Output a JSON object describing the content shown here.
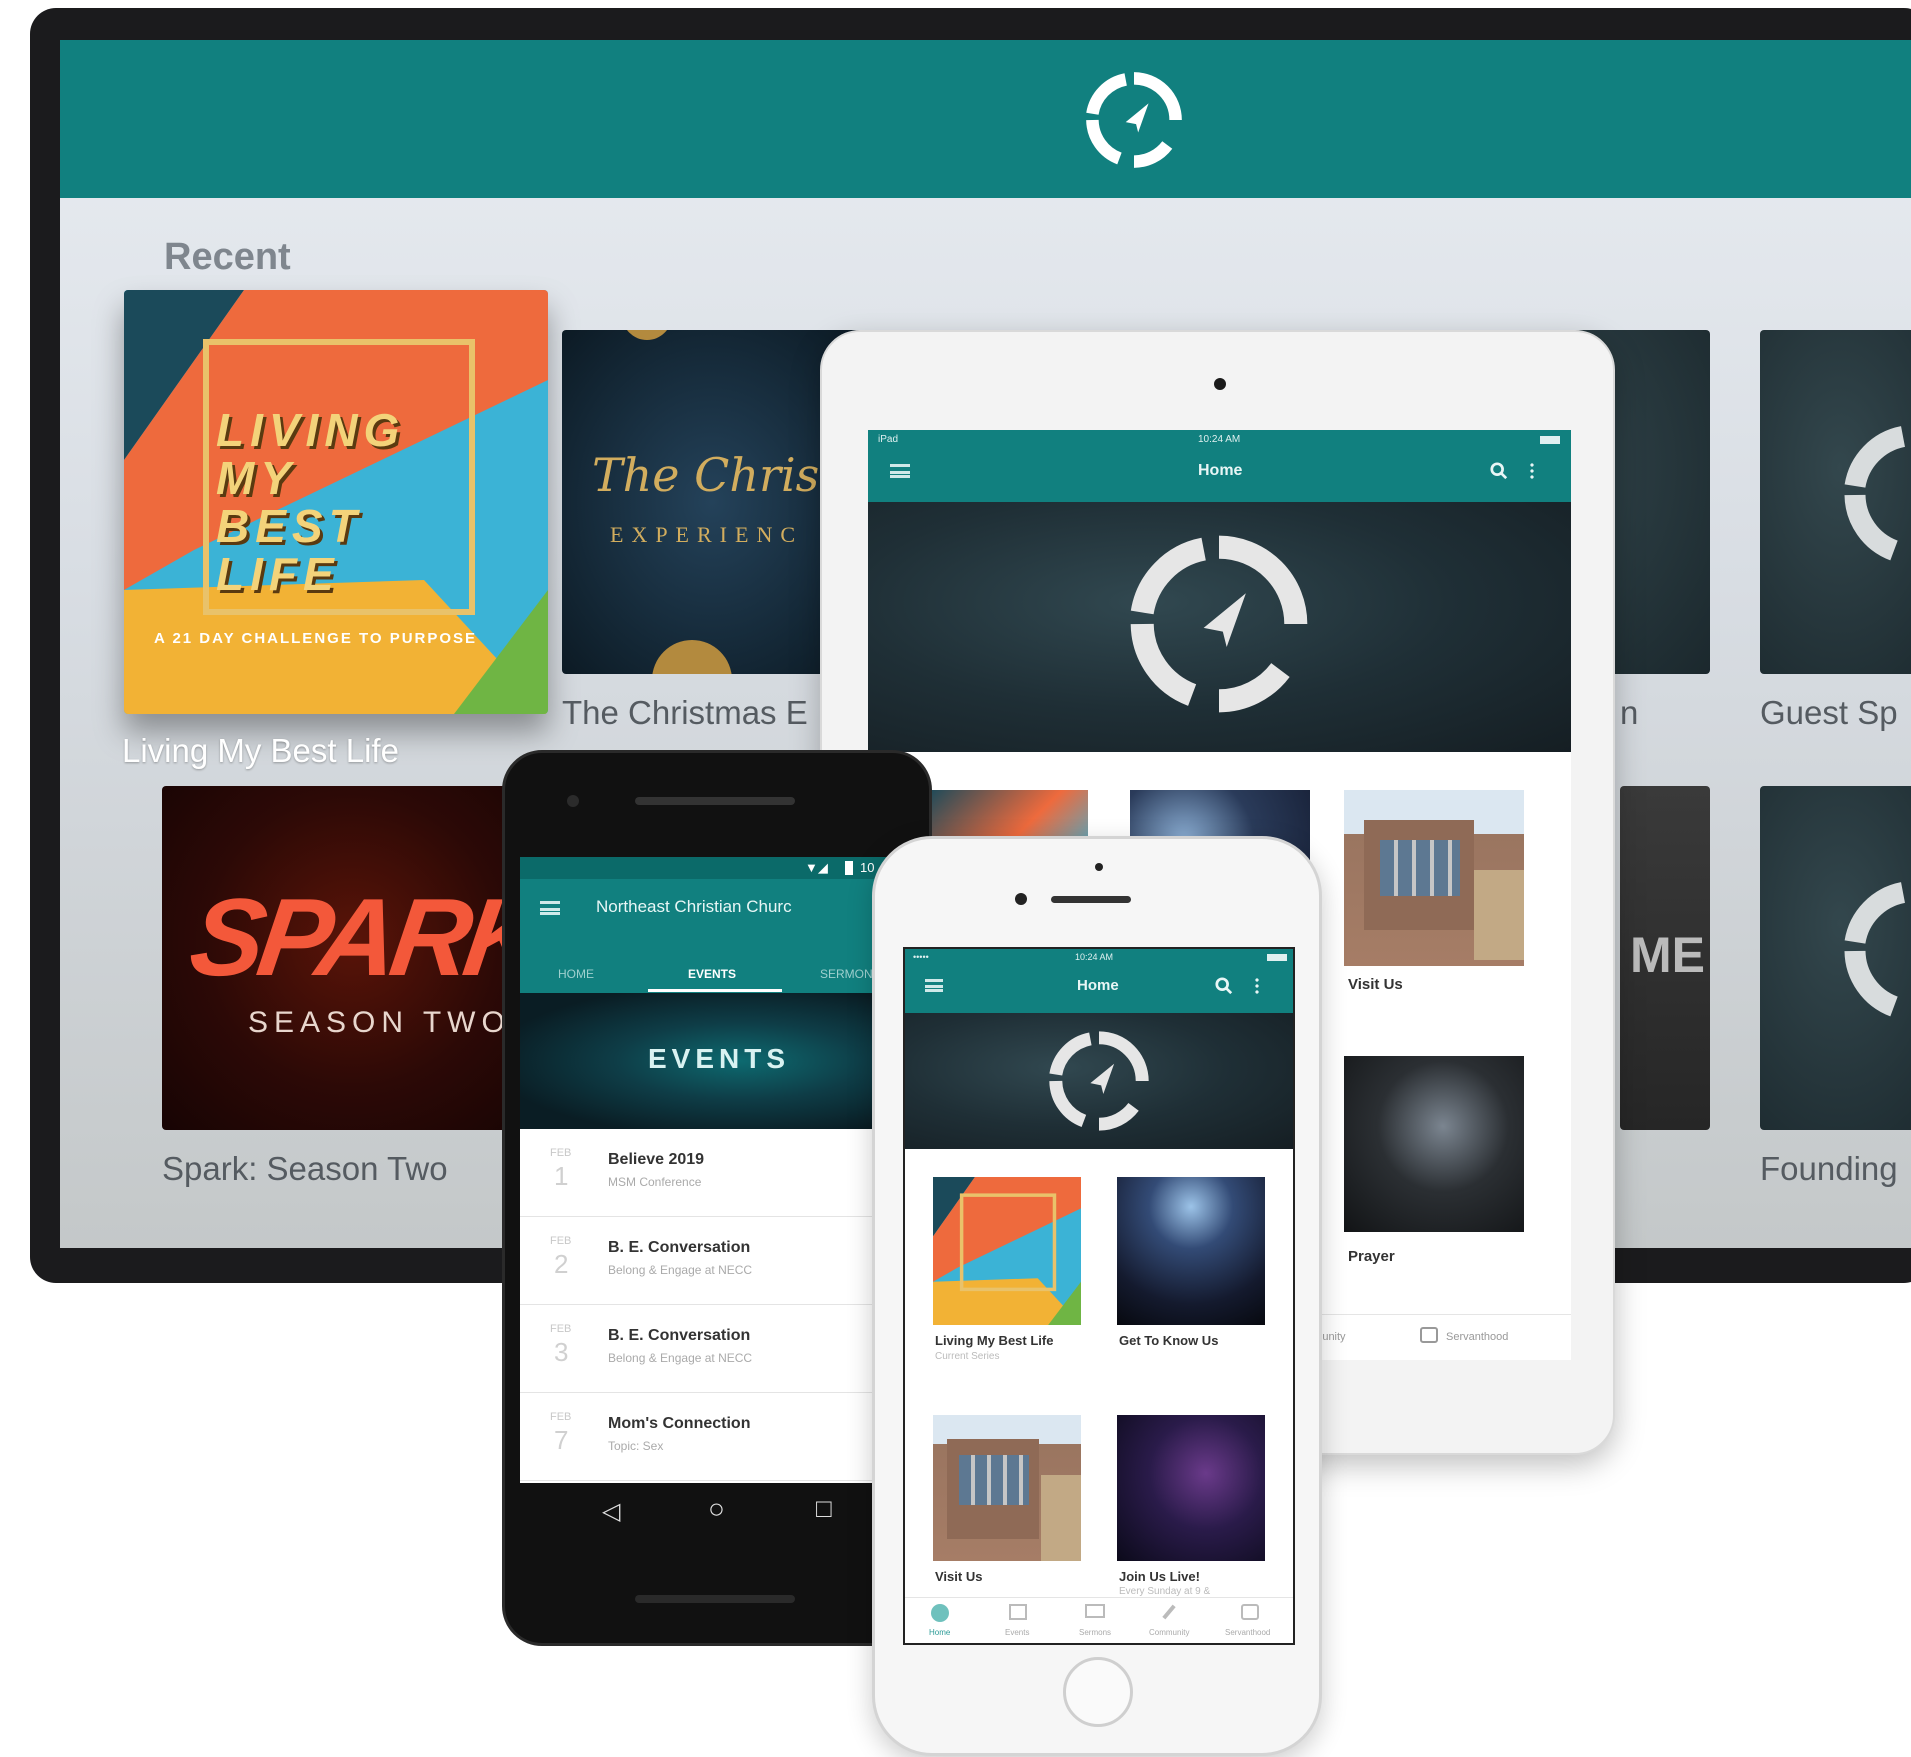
{
  "tv": {
    "section_title": "Recent",
    "cards": [
      {
        "label": "Living My Best Life",
        "art": {
          "lines": [
            "LIVING",
            "MY",
            "BEST",
            "LIFE"
          ],
          "tagline": "A 21 DAY CHALLENGE TO PURPOSE"
        }
      },
      {
        "label": "The Christmas E",
        "art": {
          "script": "The Christmas",
          "sub": "EXPERIENC"
        }
      },
      {
        "label": "n"
      },
      {
        "label": "Guest Sp"
      },
      {
        "label": "Spark: Season Two",
        "art": {
          "title": "SPARK",
          "sub": "SEASON TWO"
        }
      },
      {
        "label": "Founding"
      },
      {
        "art_text": "ME"
      }
    ],
    "colors": {
      "bar": "#11807f",
      "bezel": "#1b1b1d"
    }
  },
  "tablet": {
    "status": {
      "left": "iPad",
      "time": "10:24 AM"
    },
    "title": "Home",
    "tiles": [
      {
        "label": "Visit Us"
      },
      {
        "label": "Prayer"
      }
    ],
    "tabs": [
      "mmunity",
      "Servanthood"
    ]
  },
  "android": {
    "status_time": "10",
    "title": "Northeast Christian Churc",
    "tabs": [
      "HOME",
      "EVENTS",
      "SERMON"
    ],
    "hero": "EVENTS",
    "events": [
      {
        "month": "FEB",
        "day": "1",
        "title": "Believe 2019",
        "sub": "MSM Conference"
      },
      {
        "month": "FEB",
        "day": "2",
        "title": "B. E. Conversation",
        "sub": "Belong & Engage at NECC"
      },
      {
        "month": "FEB",
        "day": "3",
        "title": "B. E. Conversation",
        "sub": "Belong & Engage at NECC"
      },
      {
        "month": "FEB",
        "day": "7",
        "title": "Mom's Connection",
        "sub": "Topic: Sex"
      }
    ],
    "nav": [
      "◁",
      "○",
      "□"
    ]
  },
  "iphone": {
    "status": {
      "left": "•••••",
      "time": "10:24 AM"
    },
    "title": "Home",
    "tiles": [
      {
        "label": "Living My Best Life",
        "sub": "Current Series"
      },
      {
        "label": "Get To Know Us",
        "sub": ""
      },
      {
        "label": "Visit Us",
        "sub": ""
      },
      {
        "label": "Join Us Live!",
        "sub": "Every Sunday at 9 &"
      }
    ],
    "tabs": [
      "Home",
      "Events",
      "Sermons",
      "Community",
      "Servanthood"
    ]
  },
  "icons": [
    "compass-logo-icon",
    "menu-icon",
    "search-icon",
    "more-vert-icon",
    "wifi-icon",
    "battery-icon"
  ]
}
